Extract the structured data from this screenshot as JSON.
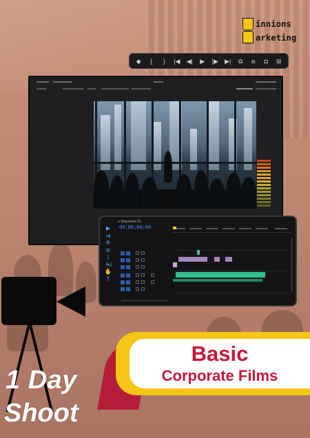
{
  "logo": {
    "line1": "innions",
    "line2": "arketing"
  },
  "transport_bar": {
    "buttons": [
      {
        "name": "marker-icon",
        "glyph": "◆"
      },
      {
        "name": "in-point-icon",
        "glyph": "{"
      },
      {
        "name": "out-point-icon",
        "glyph": "}"
      },
      {
        "name": "go-to-in-icon",
        "glyph": "|◀"
      },
      {
        "name": "step-back-icon",
        "glyph": "◀|"
      },
      {
        "name": "play-icon",
        "glyph": "▶"
      },
      {
        "name": "step-forward-icon",
        "glyph": "|▶"
      },
      {
        "name": "go-to-out-icon",
        "glyph": "▶|"
      },
      {
        "name": "insert-icon",
        "glyph": "⧉"
      },
      {
        "name": "overwrite-icon",
        "glyph": "⧈"
      },
      {
        "name": "export-frame-icon",
        "glyph": "◘"
      },
      {
        "name": "button-editor-icon",
        "glyph": "⊞"
      }
    ]
  },
  "timeline": {
    "tab_label": "≡  Sequence 01",
    "timecode": "00;00;00;00"
  },
  "tools": [
    "▶",
    "⇉",
    "✣",
    "⊘",
    "|↔|",
    "✎",
    "✋",
    "T"
  ],
  "banner": {
    "title": "Basic",
    "subtitle": "Corporate Films"
  },
  "tagline": {
    "line1": "1 Day",
    "line2": "Shoot"
  },
  "colors": {
    "brand_yellow": "#f5c518",
    "brand_red": "#c8183a",
    "clip_purple": "#a785c0",
    "clip_green": "#2fbf8c",
    "accent_blue": "#3f8cf0"
  }
}
